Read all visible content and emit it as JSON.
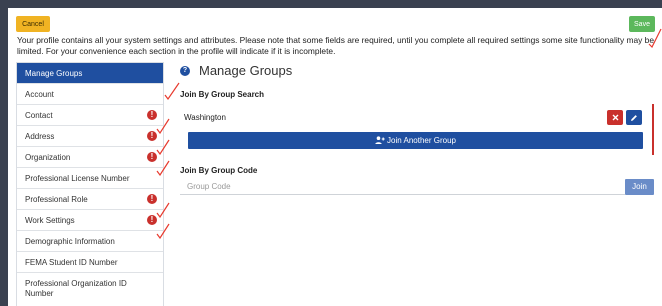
{
  "toolbar": {
    "cancel_label": "Cancel",
    "save_label": "Save"
  },
  "intro": "Your profile contains all your system settings and attributes. Please note that some fields are required, until you complete all required settings some site functionality may be limited. For your convenience each section in the profile will indicate if it is incomplete.",
  "sidebar": {
    "items": [
      {
        "label": "Manage Groups",
        "active": true,
        "incomplete": false
      },
      {
        "label": "Account",
        "incomplete": false
      },
      {
        "label": "Contact",
        "incomplete": true
      },
      {
        "label": "Address",
        "incomplete": true
      },
      {
        "label": "Organization",
        "incomplete": true
      },
      {
        "label": "Professional License Number",
        "incomplete": false
      },
      {
        "label": "Professional Role",
        "incomplete": true
      },
      {
        "label": "Work Settings",
        "incomplete": true
      },
      {
        "label": "Demographic Information",
        "incomplete": false
      },
      {
        "label": "FEMA Student ID Number",
        "incomplete": false
      },
      {
        "label": "Professional Organization ID Number",
        "incomplete": false
      }
    ],
    "warning_glyph": "!"
  },
  "main": {
    "help_glyph": "?",
    "title": "Manage Groups",
    "search_section_label": "Join By Group Search",
    "group_name": "Washington",
    "join_another_label": "Join Another Group",
    "code_section_label": "Join By Group Code",
    "code_placeholder": "Group Code",
    "code_join_label": "Join"
  },
  "colors": {
    "primary": "#1f4fa0",
    "danger": "#c9302c",
    "warning": "#f0b323",
    "success": "#5cb85c",
    "annotation": "#e83a2e"
  },
  "icons": {
    "delete": "x-icon",
    "edit": "pencil-icon",
    "join_another": "user-plus-icon",
    "help": "question-circle-icon",
    "incomplete": "exclamation-circle-icon"
  }
}
